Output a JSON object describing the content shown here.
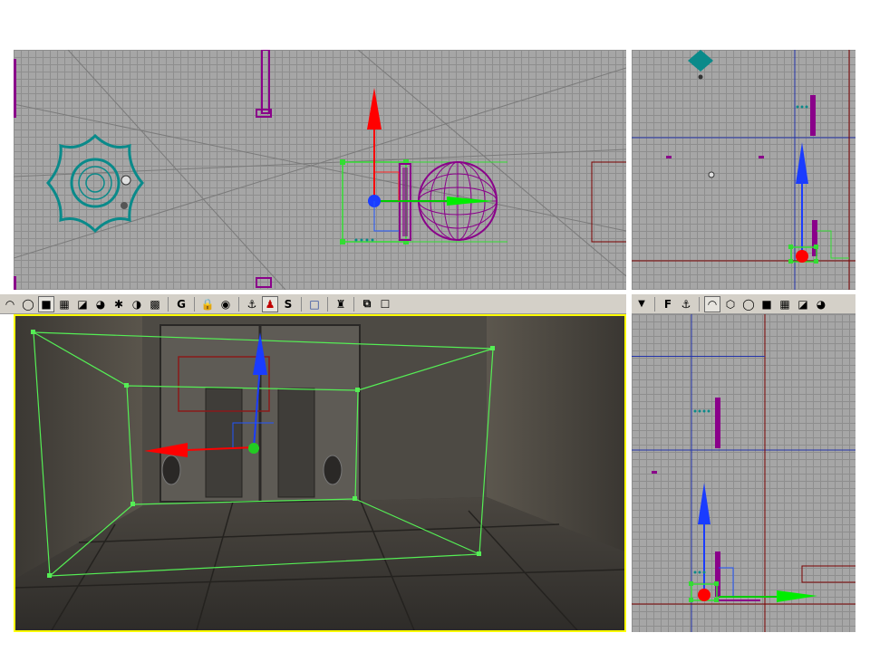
{
  "viewports": {
    "top": {
      "name": "top-view"
    },
    "side": {
      "name": "side-view"
    },
    "perspective": {
      "name": "perspective-view"
    },
    "front": {
      "name": "front-view"
    }
  },
  "toolbar_left": {
    "buttons": [
      {
        "name": "wireframe-sphere-icon",
        "glyph": "◠",
        "boxed": false
      },
      {
        "name": "sphere-outline-icon",
        "glyph": "◯",
        "boxed": false
      },
      {
        "name": "solid-cube-icon",
        "glyph": "■",
        "boxed": true
      },
      {
        "name": "textured-cube-icon",
        "glyph": "▦",
        "boxed": false
      },
      {
        "name": "lit-cube-icon",
        "glyph": "◪",
        "boxed": false
      },
      {
        "name": "shaded-sphere-icon",
        "glyph": "◕",
        "boxed": false
      },
      {
        "name": "zone-icon",
        "glyph": "✱",
        "boxed": false
      },
      {
        "name": "lighting-icon",
        "glyph": "◑",
        "boxed": false
      },
      {
        "name": "texture-usage-icon",
        "glyph": "▩",
        "boxed": false
      }
    ],
    "g_label": "G",
    "s_label": "S"
  },
  "toolbar_right": {
    "menu_arrow": "▼",
    "f_label": "F"
  }
}
